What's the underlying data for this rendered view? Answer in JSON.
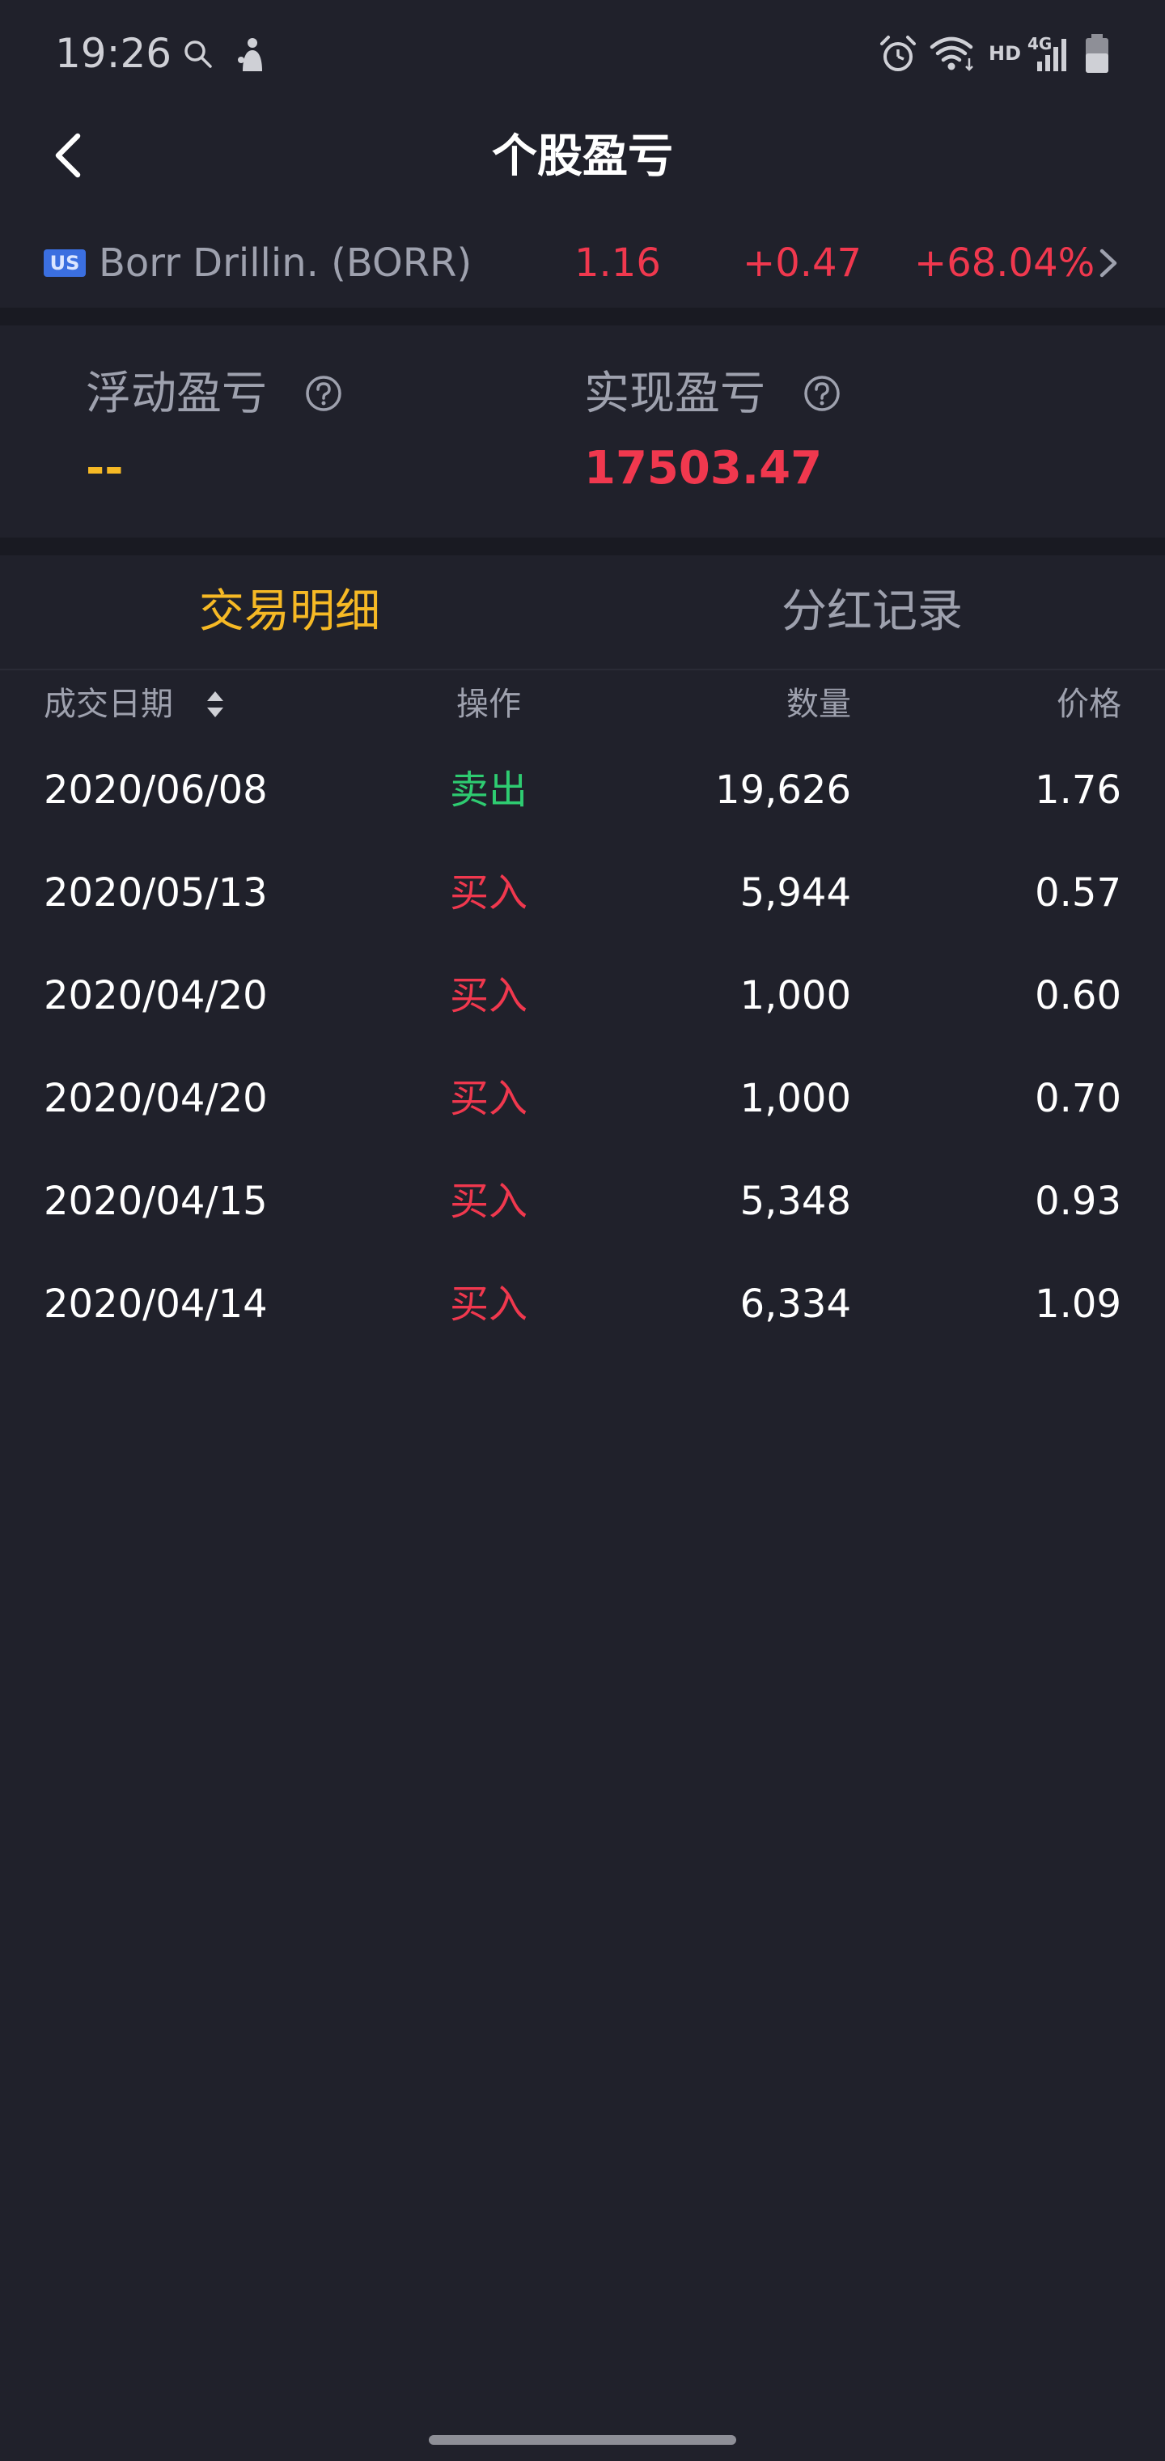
{
  "status_bar": {
    "time": "19:26",
    "network": "HD",
    "signal_type": "4G",
    "colors": {
      "icon": "#cfd0d6"
    }
  },
  "nav": {
    "title": "个股盈亏",
    "back_icon": "chevron-left-icon"
  },
  "stock": {
    "market": "US",
    "name": "Borr Drillin. (BORR)",
    "price": "1.16",
    "change": "+0.47",
    "change_pct": "+68.04%",
    "colors": {
      "up": "#f0384e",
      "badge": "#3b6fe0"
    }
  },
  "pnl": {
    "floating_label": "浮动盈亏",
    "floating_value": "--",
    "realized_label": "实现盈亏",
    "realized_value": "17503.47",
    "colors": {
      "floating": "#f6b925",
      "realized": "#f0384e"
    }
  },
  "tabs": [
    {
      "label": "交易明细",
      "active": true
    },
    {
      "label": "分红记录",
      "active": false
    }
  ],
  "table": {
    "headers": {
      "date": "成交日期",
      "operation": "操作",
      "quantity": "数量",
      "price": "价格"
    },
    "rows": [
      {
        "date": "2020/06/08",
        "operation": "卖出",
        "type": "sell",
        "quantity": "19,626",
        "price": "1.76"
      },
      {
        "date": "2020/05/13",
        "operation": "买入",
        "type": "buy",
        "quantity": "5,944",
        "price": "0.57"
      },
      {
        "date": "2020/04/20",
        "operation": "买入",
        "type": "buy",
        "quantity": "1,000",
        "price": "0.60"
      },
      {
        "date": "2020/04/20",
        "operation": "买入",
        "type": "buy",
        "quantity": "1,000",
        "price": "0.70"
      },
      {
        "date": "2020/04/15",
        "operation": "买入",
        "type": "buy",
        "quantity": "5,348",
        "price": "0.93"
      },
      {
        "date": "2020/04/14",
        "operation": "买入",
        "type": "buy",
        "quantity": "6,334",
        "price": "1.09"
      }
    ],
    "colors": {
      "sell": "#2ecc71",
      "buy": "#f0384e"
    }
  },
  "theme": {
    "background": "#20212b",
    "accent": "#f6b925",
    "muted_text": "#9ea1ae"
  }
}
